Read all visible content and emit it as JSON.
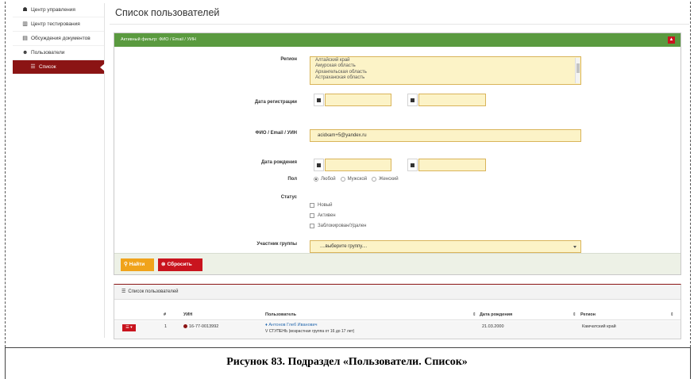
{
  "sidebar": {
    "items": [
      {
        "icon": "dashboard-icon",
        "glyph": "☗",
        "label": "Центр управления"
      },
      {
        "icon": "building-icon",
        "glyph": "▥",
        "label": "Центр тестирования"
      },
      {
        "icon": "document-icon",
        "glyph": "▤",
        "label": "Обсуждения документов"
      },
      {
        "icon": "users-icon",
        "glyph": "☻",
        "label": "Пользователи"
      },
      {
        "icon": "list-icon",
        "glyph": "☰",
        "label": "Список"
      }
    ]
  },
  "page": {
    "title": "Список пользователей"
  },
  "filter": {
    "header": "Активный фильтр: ФИО / Email / УИН",
    "collapse_glyph": "▲",
    "region_label": "Регион",
    "regions": [
      "Алтайский край",
      "Амурская область",
      "Архангельская область",
      "Астраханская область"
    ],
    "reg_date_label": "Дата регистрации",
    "fio_label": "ФИО / Email / УИН",
    "fio_value": "acidxam+5@yandex.ru",
    "birth_label": "Дата рождения",
    "gender_label": "Пол",
    "gender_options": [
      "Любой",
      "Мужской",
      "Женский"
    ],
    "gender_selected": "Любой",
    "status_label": "Статус",
    "status_options": [
      "Новый",
      "Активен",
      "Заблокирован/Удален"
    ],
    "group_label": "Участник группы",
    "group_placeholder": "....выберите группу....",
    "find_label": "Найти",
    "reset_label": "Сбросить"
  },
  "list": {
    "title": "Список пользователей",
    "columns": [
      "#",
      "УИН",
      "Пользователь",
      "Дата рождения",
      "Регион"
    ],
    "rows": [
      {
        "num": "1",
        "uin": "16-77-0013992",
        "name": "Антонов Глеб Иванович",
        "level": "V СТУПЕНЬ (возрастная группа от 16 до 17 лет)",
        "birth": "21.03.2000",
        "region": "Камчатский край"
      }
    ]
  },
  "caption": "Рисунок 83. Подраздел «Пользователи. Список»",
  "colors": {
    "accent": "#8b1414",
    "panel_head": "#5a9a3f",
    "field": "#fcf3c7",
    "find": "#f0a31b",
    "reset": "#c9141e"
  }
}
